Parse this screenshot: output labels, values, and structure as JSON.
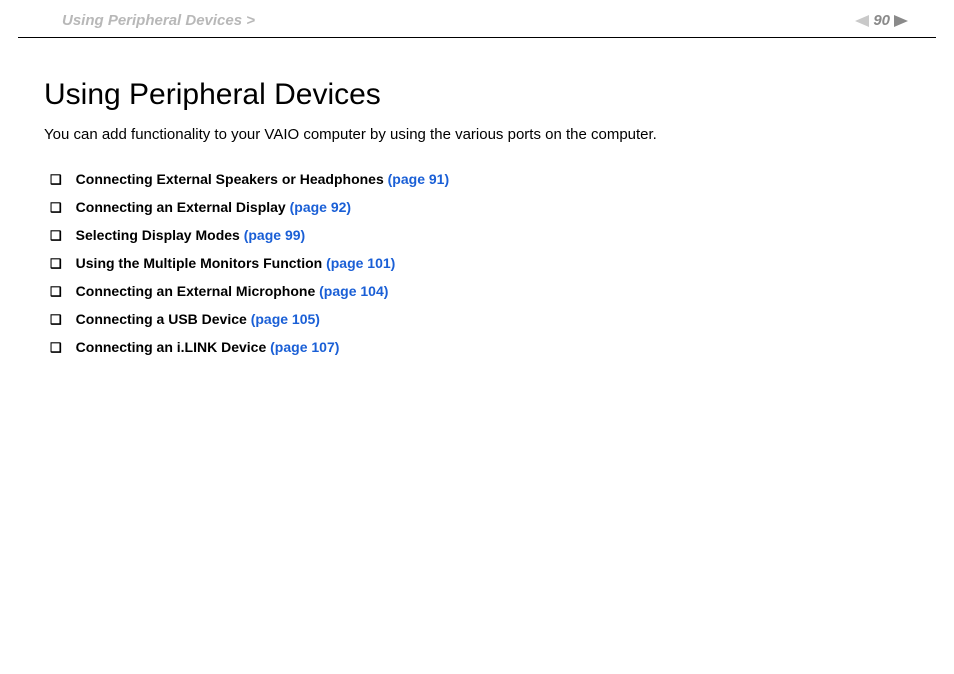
{
  "header": {
    "breadcrumb": "Using Peripheral Devices >",
    "page_number": "90"
  },
  "main": {
    "title": "Using Peripheral Devices",
    "intro": "You can add functionality to your VAIO computer by using the various ports on the computer.",
    "toc": [
      {
        "label": "Connecting External Speakers or Headphones",
        "page": "(page 91)"
      },
      {
        "label": "Connecting an External Display",
        "page": "(page 92)"
      },
      {
        "label": "Selecting Display Modes",
        "page": "(page 99)"
      },
      {
        "label": "Using the Multiple Monitors Function",
        "page": "(page 101)"
      },
      {
        "label": "Connecting an External Microphone",
        "page": "(page 104)"
      },
      {
        "label": "Connecting a USB Device",
        "page": "(page 105)"
      },
      {
        "label": "Connecting an i.LINK Device",
        "page": "(page 107)"
      }
    ]
  }
}
